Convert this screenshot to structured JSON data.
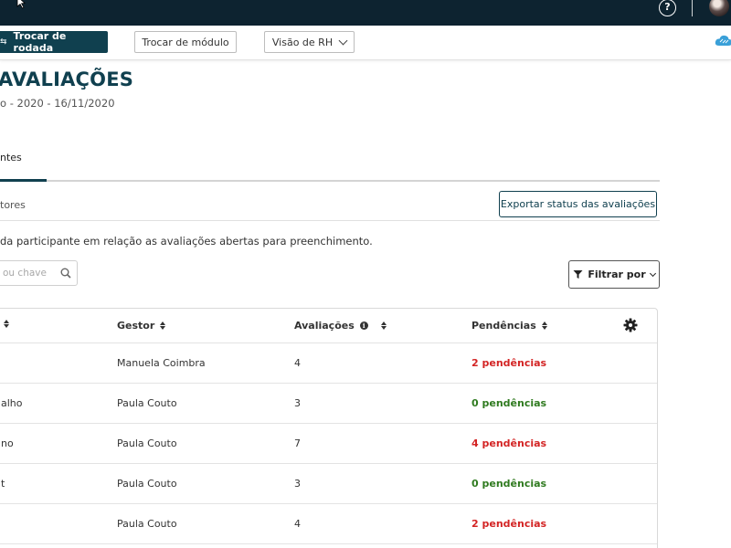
{
  "topbar": {
    "help_glyph": "?",
    "icons": [
      "cursor-arrow-icon",
      "help-icon",
      "avatar"
    ]
  },
  "subbar": {
    "switch_round_label": "Trocar de rodada",
    "switch_module_label": "Trocar de módulo",
    "hr_view_label": "Visão de RH",
    "cloud_icon": "cloud-icon"
  },
  "page": {
    "title": "AVALIAÇÕES",
    "dates": "o - 2020 - 16/11/2020"
  },
  "tabs": {
    "active_label": "ntes"
  },
  "section": {
    "sub_label": "tores",
    "export_label": "Exportar status das avaliações",
    "description": "da participante em relação as avaliações abertas para preenchimento."
  },
  "search": {
    "placeholder": "ou chave",
    "value": ""
  },
  "filter": {
    "label": "Filtrar por"
  },
  "table": {
    "headers": {
      "name": "",
      "manager": "Gestor",
      "evaluations": "Avaliações",
      "pending": "Pendências"
    },
    "rows": [
      {
        "name": "",
        "manager": "Manuela Coimbra",
        "evaluations": "4",
        "pending": "2 pendências",
        "status": "red"
      },
      {
        "name": "alho",
        "manager": "Paula Couto",
        "evaluations": "3",
        "pending": "0 pendências",
        "status": "green"
      },
      {
        "name": "no",
        "manager": "Paula Couto",
        "evaluations": "7",
        "pending": "4 pendências",
        "status": "red"
      },
      {
        "name": "t",
        "manager": "Paula Couto",
        "evaluations": "3",
        "pending": "0 pendências",
        "status": "green"
      },
      {
        "name": "",
        "manager": "Paula Couto",
        "evaluations": "4",
        "pending": "2 pendências",
        "status": "red"
      }
    ]
  },
  "colors": {
    "topbar": "#0d2330",
    "brand": "#10404f",
    "pending_red": "#d32424",
    "pending_green": "#2f7a1f",
    "cloud": "#3aa0d8"
  }
}
